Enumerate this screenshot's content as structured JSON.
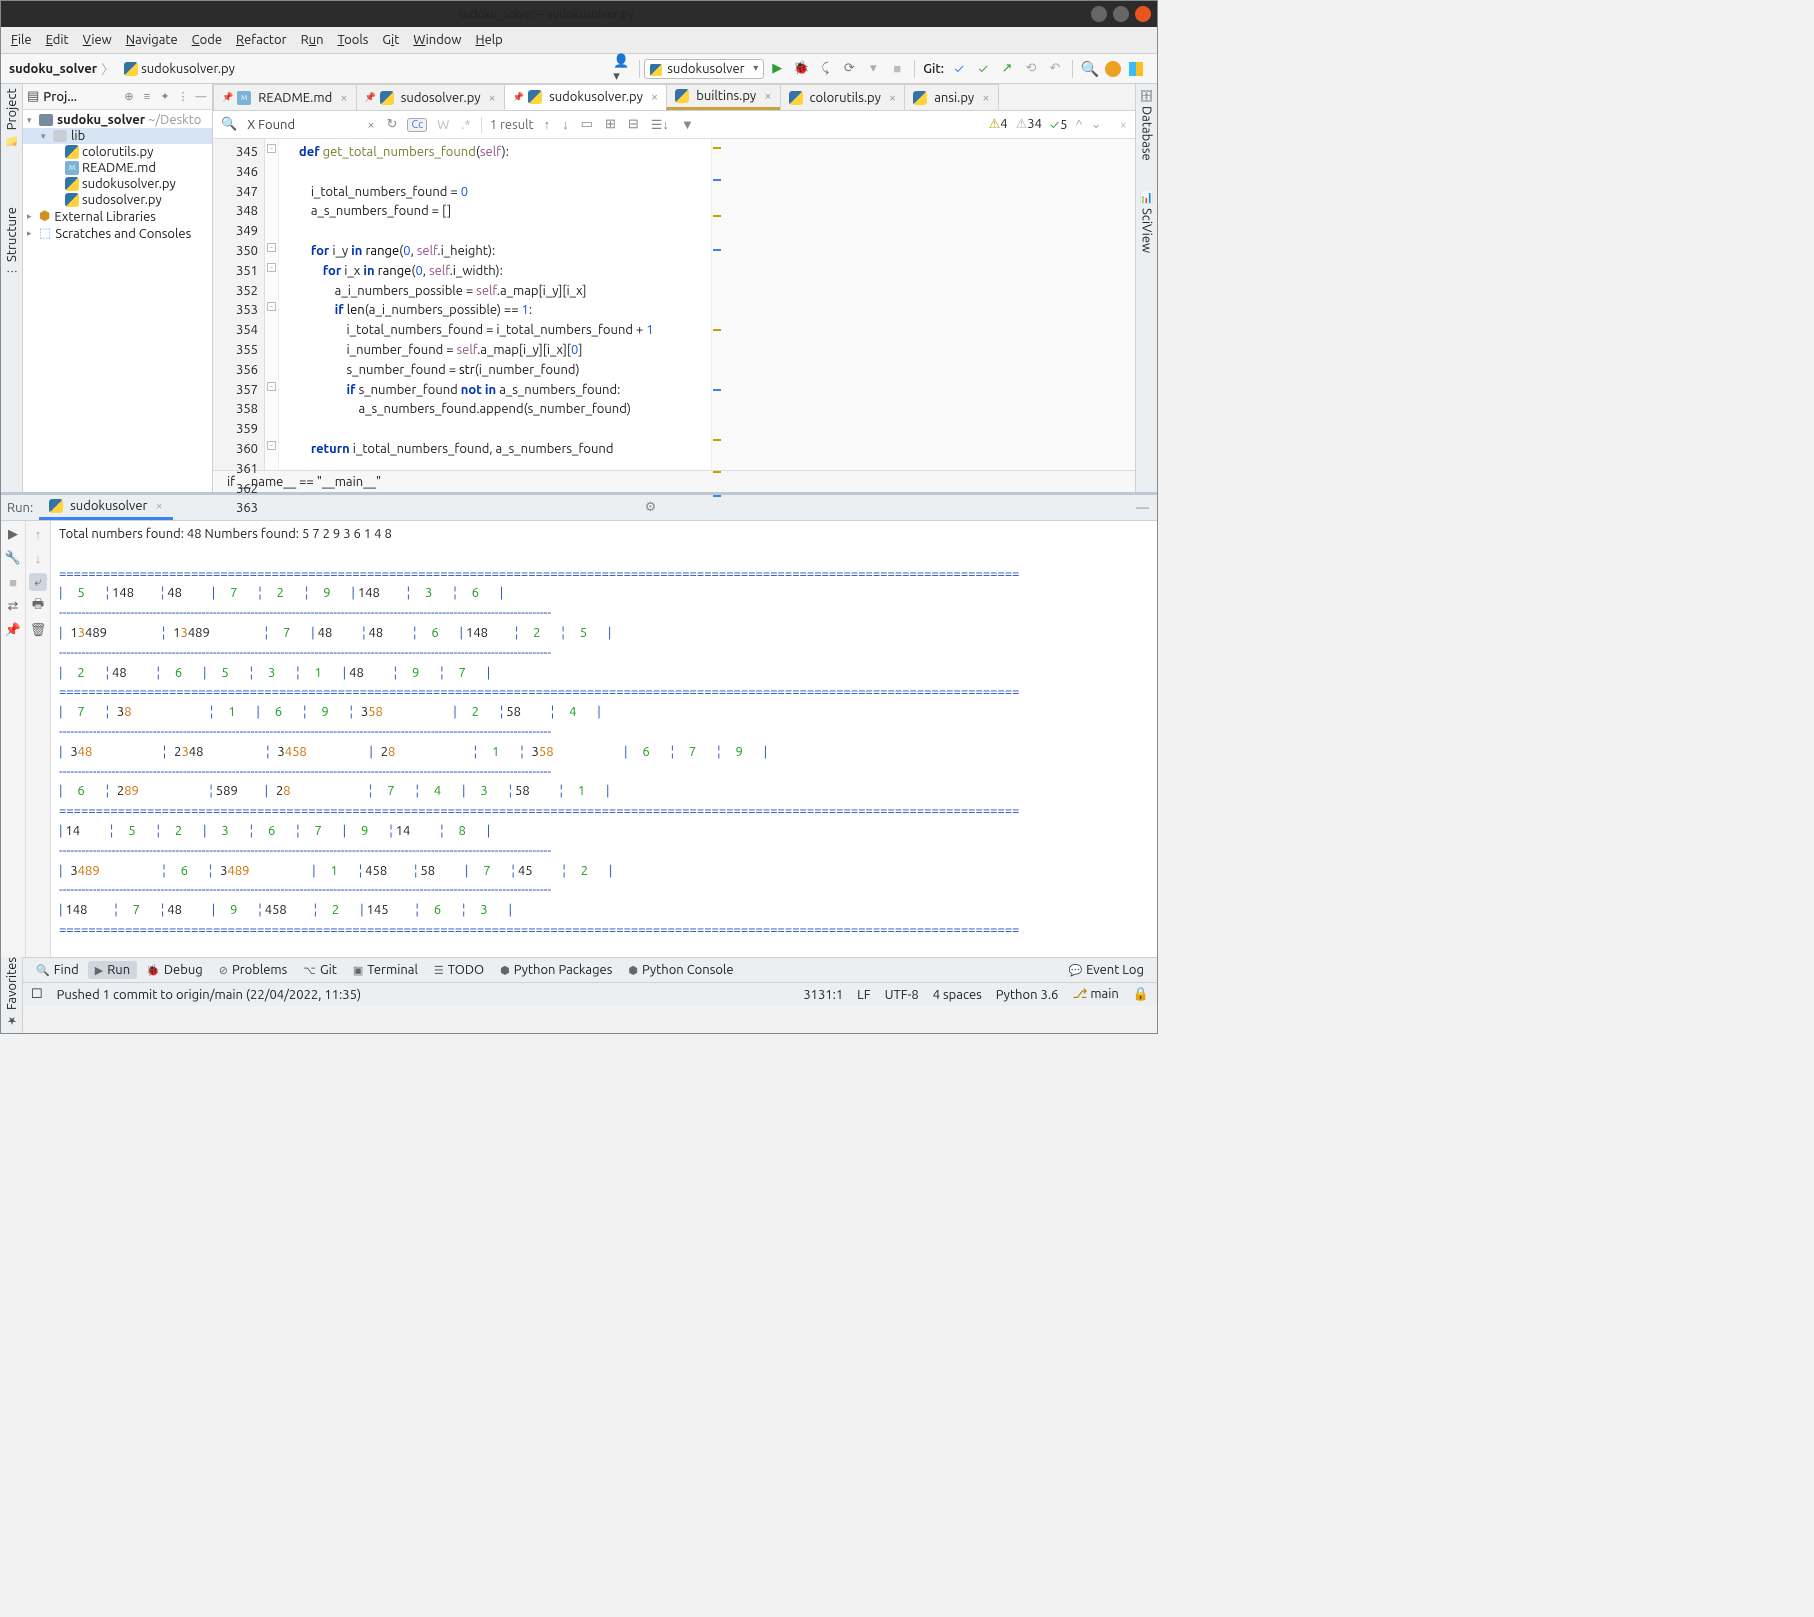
{
  "window": {
    "title": "sudoku_solver – sudokusolver.py"
  },
  "menu": {
    "file": "File",
    "edit": "Edit",
    "view": "View",
    "navigate": "Navigate",
    "code": "Code",
    "refactor": "Refactor",
    "run": "Run",
    "tools": "Tools",
    "git": "Git",
    "window": "Window",
    "help": "Help"
  },
  "toolbar": {
    "crumb_project": "sudoku_solver",
    "crumb_file": "sudokusolver.py",
    "run_config": "sudokusolver",
    "git_label": "Git:"
  },
  "leftrail": {
    "project": "Project",
    "structure": "Structure"
  },
  "rightrail": {
    "database": "Database",
    "sciview": "SciView"
  },
  "leftfav": {
    "label": "Favorites"
  },
  "project_panel": {
    "title": "Proj...",
    "root_name": "sudoku_solver",
    "root_path": "~/Deskto",
    "lib": "lib",
    "files": [
      "colorutils.py",
      "README.md",
      "sudokusolver.py",
      "sudosolver.py"
    ],
    "ext": "External Libraries",
    "scratch": "Scratches and Consoles"
  },
  "editor_tabs": {
    "t0": "README.md",
    "t1": "sudosolver.py",
    "t2": "sudokusolver.py",
    "t3": "builtins.py",
    "t4": "colorutils.py",
    "t5": "ansi.py"
  },
  "search": {
    "query": "X Found",
    "result": "1 result"
  },
  "inspections": {
    "warn": "4",
    "weak": "34",
    "ok": "5"
  },
  "gutter": {
    "lines": [
      "345",
      "346",
      "347",
      "348",
      "349",
      "350",
      "351",
      "352",
      "353",
      "354",
      "355",
      "356",
      "357",
      "358",
      "359",
      "360",
      "361",
      "362",
      "363"
    ]
  },
  "code_lines": [
    {
      "ind": 4,
      "seg": [
        {
          "t": "def ",
          "c": "kw"
        },
        {
          "t": "get_total_numbers_found",
          "c": "fn"
        },
        {
          "t": "("
        },
        {
          "t": "self",
          "c": "self"
        },
        {
          "t": "):"
        }
      ]
    },
    {
      "ind": 4,
      "seg": []
    },
    {
      "ind": 8,
      "seg": [
        {
          "t": "i_total_numbers_found = "
        },
        {
          "t": "0",
          "c": "num"
        }
      ]
    },
    {
      "ind": 8,
      "seg": [
        {
          "t": "a_s_numbers_found = []"
        }
      ]
    },
    {
      "ind": 4,
      "seg": []
    },
    {
      "ind": 8,
      "seg": [
        {
          "t": "for ",
          "c": "kw"
        },
        {
          "t": "i_y "
        },
        {
          "t": "in ",
          "c": "kw"
        },
        {
          "t": "range",
          "c": "bi"
        },
        {
          "t": "("
        },
        {
          "t": "0",
          "c": "num"
        },
        {
          "t": ", "
        },
        {
          "t": "self",
          "c": "self"
        },
        {
          "t": ".i_height):"
        }
      ]
    },
    {
      "ind": 12,
      "seg": [
        {
          "t": "for ",
          "c": "kw"
        },
        {
          "t": "i_x "
        },
        {
          "t": "in ",
          "c": "kw"
        },
        {
          "t": "range",
          "c": "bi"
        },
        {
          "t": "("
        },
        {
          "t": "0",
          "c": "num"
        },
        {
          "t": ", "
        },
        {
          "t": "self",
          "c": "self"
        },
        {
          "t": ".i_width):"
        }
      ]
    },
    {
      "ind": 16,
      "seg": [
        {
          "t": "a_i_numbers_possible = "
        },
        {
          "t": "self",
          "c": "self"
        },
        {
          "t": ".a_map[i_y][i_x]"
        }
      ]
    },
    {
      "ind": 16,
      "seg": [
        {
          "t": "if ",
          "c": "kw"
        },
        {
          "t": "len",
          "c": "bi"
        },
        {
          "t": "(a_i_numbers_possible) == "
        },
        {
          "t": "1",
          "c": "num"
        },
        {
          "t": ":"
        }
      ]
    },
    {
      "ind": 20,
      "seg": [
        {
          "t": "i_total_numbers_found = i_total_numbers_found + "
        },
        {
          "t": "1",
          "c": "num"
        }
      ]
    },
    {
      "ind": 20,
      "seg": [
        {
          "t": "i_number_found = "
        },
        {
          "t": "self",
          "c": "self"
        },
        {
          "t": ".a_map[i_y][i_x]["
        },
        {
          "t": "0",
          "c": "num"
        },
        {
          "t": "]"
        }
      ]
    },
    {
      "ind": 20,
      "seg": [
        {
          "t": "s_number_found = "
        },
        {
          "t": "str",
          "c": "bi"
        },
        {
          "t": "(i_number_found)"
        }
      ]
    },
    {
      "ind": 20,
      "seg": [
        {
          "t": "if ",
          "c": "kw"
        },
        {
          "t": "s_number_found "
        },
        {
          "t": "not in ",
          "c": "kw"
        },
        {
          "t": "a_s_numbers_found:"
        }
      ]
    },
    {
      "ind": 24,
      "seg": [
        {
          "t": "a_s_numbers_found.append(s_number_found)"
        }
      ]
    },
    {
      "ind": 4,
      "seg": []
    },
    {
      "ind": 8,
      "seg": [
        {
          "t": "return ",
          "c": "kw"
        },
        {
          "t": "i_total_numbers_found, a_s_numbers_found"
        }
      ]
    },
    {
      "ind": 0,
      "seg": []
    },
    {
      "ind": 0,
      "seg": []
    },
    {
      "ind": 0,
      "hl": true,
      "seg": [
        {
          "t": "if ",
          "c": "kw"
        },
        {
          "t": "__name__ == "
        },
        {
          "t": "\"__main__\"",
          "c": "fn"
        },
        {
          "t": ":"
        }
      ]
    }
  ],
  "crumb_bar": "if __name__ == \"__main__\"",
  "run": {
    "label": "Run:",
    "tab": "sudokusolver",
    "top": "Total numbers found: 48 Numbers found: 5 7 2 9 3 6 1 4 8",
    "sep_double": "===================================================================================================================================",
    "sep_single": "-----------------------------------------------------------------------------------------------------------------------------------",
    "rows": [
      [
        [
          "5",
          "gr"
        ],
        [
          "148",
          "bk"
        ],
        [
          "48",
          "bk"
        ],
        [
          "7",
          "gr"
        ],
        [
          "2",
          "gr"
        ],
        [
          "9",
          "gr"
        ],
        [
          "148",
          "bk"
        ],
        [
          "3",
          "gr"
        ],
        [
          "6",
          "gr"
        ]
      ],
      [
        [
          "13489",
          "m",
          "1 3 489"
        ],
        [
          "13489",
          "m",
          "1 3 489"
        ],
        [
          "7",
          "gr"
        ],
        [
          "48",
          "bk"
        ],
        [
          "48",
          "bk"
        ],
        [
          "6",
          "gr"
        ],
        [
          "148",
          "bk"
        ],
        [
          "2",
          "gr"
        ],
        [
          "5",
          "gr"
        ]
      ],
      [
        [
          "2",
          "gr"
        ],
        [
          "48",
          "bk"
        ],
        [
          "6",
          "gr"
        ],
        [
          "5",
          "gr"
        ],
        [
          "3",
          "gr"
        ],
        [
          "1",
          "gr"
        ],
        [
          "48",
          "bk"
        ],
        [
          "9",
          "gr"
        ],
        [
          "7",
          "gr"
        ]
      ],
      [
        [
          "7",
          "gr"
        ],
        [
          "38",
          "m",
          " 3 8"
        ],
        [
          "1",
          "gr"
        ],
        [
          "6",
          "gr"
        ],
        [
          "9",
          "gr"
        ],
        [
          "358",
          "m",
          " 3 58"
        ],
        [
          "2",
          "gr"
        ],
        [
          "58",
          "bk"
        ],
        [
          "4",
          "gr"
        ]
      ],
      [
        [
          "348",
          "m",
          " 3 48"
        ],
        [
          "2348",
          "m",
          "2 3 48"
        ],
        [
          "3458",
          "m",
          " 3 458"
        ],
        [
          "28",
          "m",
          "2 8"
        ],
        [
          "1",
          "gr"
        ],
        [
          "358",
          "m",
          " 3 58"
        ],
        [
          "6",
          "gr"
        ],
        [
          "7",
          "gr"
        ],
        [
          "9",
          "gr"
        ]
      ],
      [
        [
          "6",
          "gr"
        ],
        [
          "289",
          "m",
          "2 89"
        ],
        [
          "589",
          "bk"
        ],
        [
          "28",
          "m",
          "2 8"
        ],
        [
          "7",
          "gr"
        ],
        [
          "4",
          "gr"
        ],
        [
          "3",
          "gr"
        ],
        [
          "58",
          "bk"
        ],
        [
          "1",
          "gr"
        ]
      ],
      [
        [
          "14",
          "bk"
        ],
        [
          "5",
          "gr"
        ],
        [
          "2",
          "gr"
        ],
        [
          "3",
          "gr"
        ],
        [
          "6",
          "gr"
        ],
        [
          "7",
          "gr"
        ],
        [
          "9",
          "gr"
        ],
        [
          "14",
          "bk"
        ],
        [
          "8",
          "gr"
        ]
      ],
      [
        [
          "3489",
          "m",
          " 3 489"
        ],
        [
          "6",
          "gr"
        ],
        [
          "3489",
          "m",
          " 3 489"
        ],
        [
          "1",
          "gr"
        ],
        [
          "458",
          "bk"
        ],
        [
          "58",
          "bk"
        ],
        [
          "7",
          "gr"
        ],
        [
          "45",
          "bk"
        ],
        [
          "2",
          "gr"
        ]
      ],
      [
        [
          "148",
          "bk"
        ],
        [
          "7",
          "gr"
        ],
        [
          "48",
          "bk"
        ],
        [
          "9",
          "gr"
        ],
        [
          "458",
          "bk"
        ],
        [
          "2",
          "gr"
        ],
        [
          "145",
          "bk"
        ],
        [
          "6",
          "gr"
        ],
        [
          "3",
          "gr"
        ]
      ]
    ]
  },
  "bottom_tabs": {
    "find": "Find",
    "run": "Run",
    "debug": "Debug",
    "problems": "Problems",
    "git": "Git",
    "terminal": "Terminal",
    "todo": "TODO",
    "packages": "Python Packages",
    "console": "Python Console",
    "eventlog": "Event Log"
  },
  "status": {
    "msg": "Pushed 1 commit to origin/main (22/04/2022, 11:35)",
    "pos": "3131:1",
    "lf": "LF",
    "enc": "UTF-8",
    "indent": "4 spaces",
    "python": "Python 3.6",
    "branch": "main"
  }
}
